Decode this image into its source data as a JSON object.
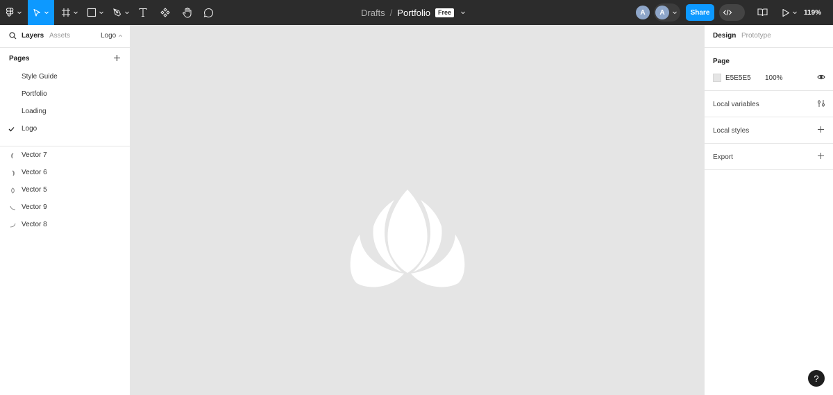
{
  "toolbar": {
    "breadcrumb_root": "Drafts",
    "breadcrumb_sep": "/",
    "file_name": "Portfolio",
    "plan_badge": "Free",
    "share_label": "Share",
    "zoom": "119%",
    "avatars": [
      "A",
      "A"
    ]
  },
  "left_panel": {
    "tab_layers": "Layers",
    "tab_assets": "Assets",
    "current_page": "Logo",
    "pages_title": "Pages",
    "pages": [
      {
        "label": "Style Guide",
        "active": false
      },
      {
        "label": "Portfolio",
        "active": false
      },
      {
        "label": "Loading",
        "active": false
      },
      {
        "label": "Logo",
        "active": true
      }
    ],
    "layers": [
      {
        "label": "Vector 7",
        "icon": "vector-icon"
      },
      {
        "label": "Vector 6",
        "icon": "vector-icon"
      },
      {
        "label": "Vector 5",
        "icon": "vector-icon"
      },
      {
        "label": "Vector 9",
        "icon": "vector-icon"
      },
      {
        "label": "Vector 8",
        "icon": "vector-icon"
      }
    ]
  },
  "right_panel": {
    "tab_design": "Design",
    "tab_prototype": "Prototype",
    "page_title": "Page",
    "page_color_hex": "E5E5E5",
    "page_opacity": "100%",
    "local_variables": "Local variables",
    "local_styles": "Local styles",
    "export": "Export"
  },
  "help_label": "?",
  "colors": {
    "toolbar_bg": "#2c2c2c",
    "accent": "#0d99ff",
    "canvas_bg": "#e5e5e5",
    "logo_fill": "#ffffff"
  }
}
